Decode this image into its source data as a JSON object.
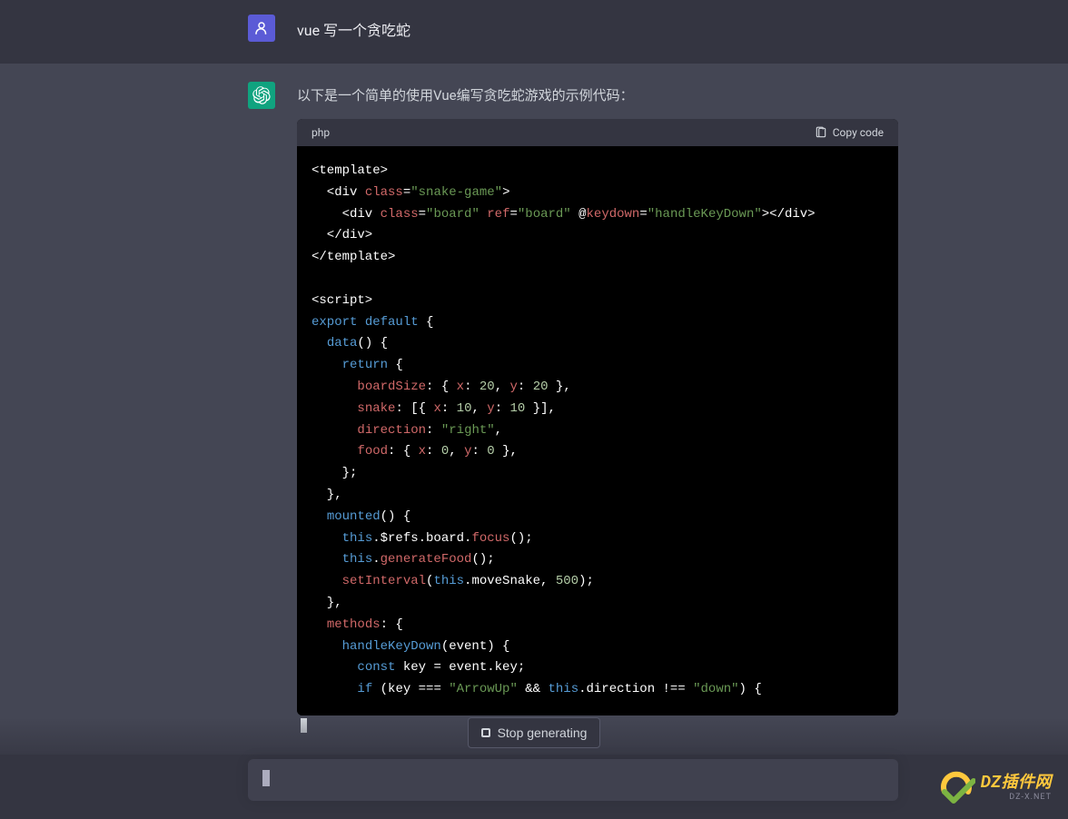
{
  "user": {
    "message": "vue 写一个贪吃蛇"
  },
  "assistant": {
    "intro": "以下是一个简单的使用Vue编写贪吃蛇游戏的示例代码：",
    "code": {
      "lang": "php",
      "copy_label": "Copy code",
      "lines": [
        {
          "tokens": [
            {
              "t": "<template>",
              "c": "c-white"
            }
          ]
        },
        {
          "tokens": [
            {
              "t": "  <div ",
              "c": "c-white"
            },
            {
              "t": "class",
              "c": "c-attr"
            },
            {
              "t": "=",
              "c": "c-white"
            },
            {
              "t": "\"snake-game\"",
              "c": "c-string"
            },
            {
              "t": ">",
              "c": "c-white"
            }
          ]
        },
        {
          "tokens": [
            {
              "t": "    <div ",
              "c": "c-white"
            },
            {
              "t": "class",
              "c": "c-attr"
            },
            {
              "t": "=",
              "c": "c-white"
            },
            {
              "t": "\"board\"",
              "c": "c-string"
            },
            {
              "t": " ",
              "c": "c-white"
            },
            {
              "t": "ref",
              "c": "c-attr"
            },
            {
              "t": "=",
              "c": "c-white"
            },
            {
              "t": "\"board\"",
              "c": "c-string"
            },
            {
              "t": " @",
              "c": "c-white"
            },
            {
              "t": "keydown",
              "c": "c-attr"
            },
            {
              "t": "=",
              "c": "c-white"
            },
            {
              "t": "\"handleKeyDown\"",
              "c": "c-string"
            },
            {
              "t": "></div>",
              "c": "c-white"
            }
          ]
        },
        {
          "tokens": [
            {
              "t": "  </div>",
              "c": "c-white"
            }
          ]
        },
        {
          "tokens": [
            {
              "t": "</template>",
              "c": "c-white"
            }
          ]
        },
        {
          "tokens": [
            {
              "t": "",
              "c": "c-white"
            }
          ]
        },
        {
          "tokens": [
            {
              "t": "<script>",
              "c": "c-white"
            }
          ]
        },
        {
          "tokens": [
            {
              "t": "export",
              "c": "c-keyword"
            },
            {
              "t": " ",
              "c": "c-white"
            },
            {
              "t": "default",
              "c": "c-keyword"
            },
            {
              "t": " {",
              "c": "c-white"
            }
          ]
        },
        {
          "tokens": [
            {
              "t": "  ",
              "c": "c-white"
            },
            {
              "t": "data",
              "c": "c-func"
            },
            {
              "t": "() {",
              "c": "c-white"
            }
          ]
        },
        {
          "tokens": [
            {
              "t": "    ",
              "c": "c-white"
            },
            {
              "t": "return",
              "c": "c-keyword"
            },
            {
              "t": " {",
              "c": "c-white"
            }
          ]
        },
        {
          "tokens": [
            {
              "t": "      ",
              "c": "c-white"
            },
            {
              "t": "boardSize",
              "c": "c-method"
            },
            {
              "t": ": { ",
              "c": "c-white"
            },
            {
              "t": "x",
              "c": "c-method"
            },
            {
              "t": ": ",
              "c": "c-white"
            },
            {
              "t": "20",
              "c": "c-num"
            },
            {
              "t": ", ",
              "c": "c-white"
            },
            {
              "t": "y",
              "c": "c-method"
            },
            {
              "t": ": ",
              "c": "c-white"
            },
            {
              "t": "20",
              "c": "c-num"
            },
            {
              "t": " },",
              "c": "c-white"
            }
          ]
        },
        {
          "tokens": [
            {
              "t": "      ",
              "c": "c-white"
            },
            {
              "t": "snake",
              "c": "c-method"
            },
            {
              "t": ": [{ ",
              "c": "c-white"
            },
            {
              "t": "x",
              "c": "c-method"
            },
            {
              "t": ": ",
              "c": "c-white"
            },
            {
              "t": "10",
              "c": "c-num"
            },
            {
              "t": ", ",
              "c": "c-white"
            },
            {
              "t": "y",
              "c": "c-method"
            },
            {
              "t": ": ",
              "c": "c-white"
            },
            {
              "t": "10",
              "c": "c-num"
            },
            {
              "t": " }],",
              "c": "c-white"
            }
          ]
        },
        {
          "tokens": [
            {
              "t": "      ",
              "c": "c-white"
            },
            {
              "t": "direction",
              "c": "c-method"
            },
            {
              "t": ": ",
              "c": "c-white"
            },
            {
              "t": "\"right\"",
              "c": "c-string"
            },
            {
              "t": ",",
              "c": "c-white"
            }
          ]
        },
        {
          "tokens": [
            {
              "t": "      ",
              "c": "c-white"
            },
            {
              "t": "food",
              "c": "c-method"
            },
            {
              "t": ": { ",
              "c": "c-white"
            },
            {
              "t": "x",
              "c": "c-method"
            },
            {
              "t": ": ",
              "c": "c-white"
            },
            {
              "t": "0",
              "c": "c-num"
            },
            {
              "t": ", ",
              "c": "c-white"
            },
            {
              "t": "y",
              "c": "c-method"
            },
            {
              "t": ": ",
              "c": "c-white"
            },
            {
              "t": "0",
              "c": "c-num"
            },
            {
              "t": " },",
              "c": "c-white"
            }
          ]
        },
        {
          "tokens": [
            {
              "t": "    };",
              "c": "c-white"
            }
          ]
        },
        {
          "tokens": [
            {
              "t": "  },",
              "c": "c-white"
            }
          ]
        },
        {
          "tokens": [
            {
              "t": "  ",
              "c": "c-white"
            },
            {
              "t": "mounted",
              "c": "c-func"
            },
            {
              "t": "() {",
              "c": "c-white"
            }
          ]
        },
        {
          "tokens": [
            {
              "t": "    ",
              "c": "c-white"
            },
            {
              "t": "this",
              "c": "c-this"
            },
            {
              "t": ".$refs.board.",
              "c": "c-white"
            },
            {
              "t": "focus",
              "c": "c-method"
            },
            {
              "t": "();",
              "c": "c-white"
            }
          ]
        },
        {
          "tokens": [
            {
              "t": "    ",
              "c": "c-white"
            },
            {
              "t": "this",
              "c": "c-this"
            },
            {
              "t": ".",
              "c": "c-white"
            },
            {
              "t": "generateFood",
              "c": "c-method"
            },
            {
              "t": "();",
              "c": "c-white"
            }
          ]
        },
        {
          "tokens": [
            {
              "t": "    ",
              "c": "c-white"
            },
            {
              "t": "setInterval",
              "c": "c-method"
            },
            {
              "t": "(",
              "c": "c-white"
            },
            {
              "t": "this",
              "c": "c-this"
            },
            {
              "t": ".moveSnake, ",
              "c": "c-white"
            },
            {
              "t": "500",
              "c": "c-num"
            },
            {
              "t": ");",
              "c": "c-white"
            }
          ]
        },
        {
          "tokens": [
            {
              "t": "  },",
              "c": "c-white"
            }
          ]
        },
        {
          "tokens": [
            {
              "t": "  ",
              "c": "c-white"
            },
            {
              "t": "methods",
              "c": "c-method"
            },
            {
              "t": ": {",
              "c": "c-white"
            }
          ]
        },
        {
          "tokens": [
            {
              "t": "    ",
              "c": "c-white"
            },
            {
              "t": "handleKeyDown",
              "c": "c-func"
            },
            {
              "t": "(event) {",
              "c": "c-white"
            }
          ]
        },
        {
          "tokens": [
            {
              "t": "      ",
              "c": "c-white"
            },
            {
              "t": "const",
              "c": "c-const"
            },
            {
              "t": " key = event.key;",
              "c": "c-white"
            }
          ]
        },
        {
          "tokens": [
            {
              "t": "      ",
              "c": "c-white"
            },
            {
              "t": "if",
              "c": "c-keyword"
            },
            {
              "t": " (key === ",
              "c": "c-white"
            },
            {
              "t": "\"ArrowUp\"",
              "c": "c-string"
            },
            {
              "t": " && ",
              "c": "c-white"
            },
            {
              "t": "this",
              "c": "c-this"
            },
            {
              "t": ".direction !== ",
              "c": "c-white"
            },
            {
              "t": "\"down\"",
              "c": "c-string"
            },
            {
              "t": ") {",
              "c": "c-white"
            }
          ]
        }
      ]
    }
  },
  "controls": {
    "stop_label": "Stop generating"
  },
  "watermark": {
    "main": "DZ插件网",
    "sub": "DZ-X.NET"
  }
}
